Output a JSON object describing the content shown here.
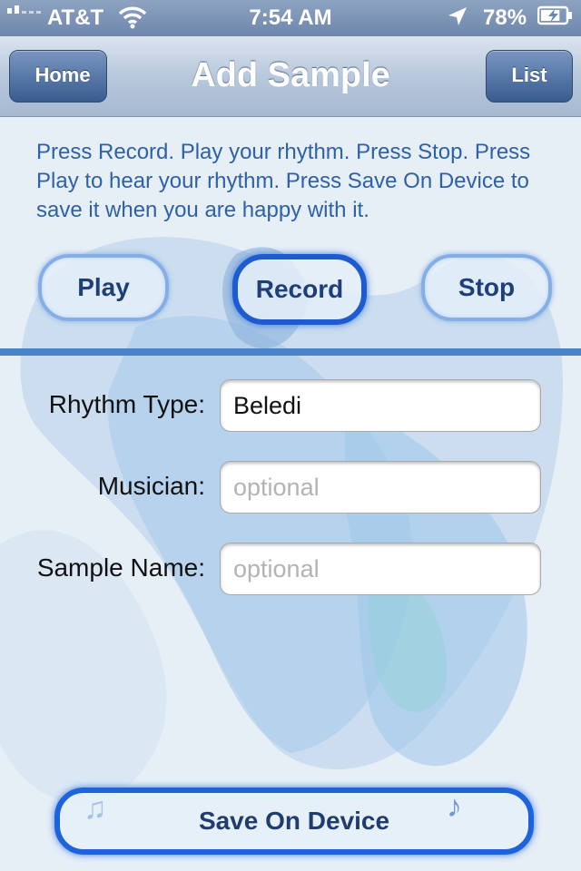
{
  "status_bar": {
    "carrier": "AT&T",
    "time": "7:54 AM",
    "battery_percent": "78%",
    "battery_level": 0.78
  },
  "nav": {
    "title": "Add Sample",
    "back_label": "Home",
    "right_label": "List"
  },
  "instructions": "Press Record.  Play your rhythm. Press Stop. Press Play to hear your rhythm.  Press Save On Device to save it when you are happy with it.",
  "controls": {
    "play_label": "Play",
    "record_label": "Record",
    "stop_label": "Stop"
  },
  "form": {
    "rhythm_type_label": "Rhythm Type:",
    "rhythm_type_value": "Beledi",
    "musician_label": "Musician:",
    "musician_placeholder": "optional",
    "sample_name_label": "Sample Name:",
    "sample_name_placeholder": "optional"
  },
  "save_label": "Save On Device",
  "colors": {
    "accent": "#1f63dc",
    "instruction_text": "#2f61a8",
    "divider": "#4a83c8"
  }
}
